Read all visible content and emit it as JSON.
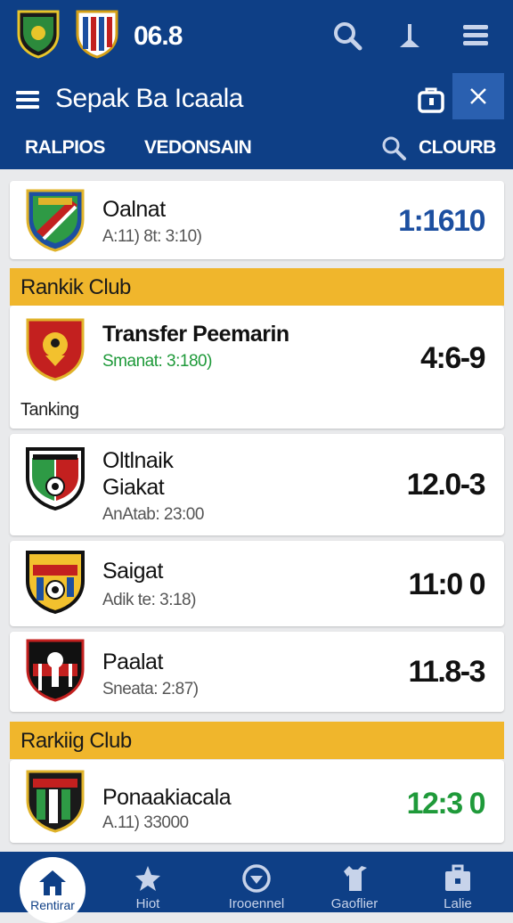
{
  "colors": {
    "appbar": "#0e3f86",
    "close_button": "#2a60b0",
    "section": "#f0b62c",
    "score_blue": "#1c4fa0",
    "score_green": "#1f9a3a",
    "background": "#e9eaec"
  },
  "topbar": {
    "score": "06.8",
    "icons": [
      "search-icon",
      "pin-icon",
      "menu-lines-icon"
    ]
  },
  "titlebar": {
    "title": "Sepak Ba Icaala",
    "icons": [
      "menu-icon",
      "bag-icon",
      "close-icon"
    ]
  },
  "tabs": [
    {
      "label": "RALPIOS"
    },
    {
      "label": "VEDONSAIN"
    },
    {
      "label": "CLOURB"
    }
  ],
  "cards": [
    {
      "name": "Oalnat",
      "sub": "A:11) 8t: 3:10)",
      "score": "1:1610"
    },
    {
      "name": "Transfer Peemarin",
      "sub": "Smanat: 3:180)",
      "score": "4:6-9",
      "footer": "Tanking"
    },
    {
      "name": "Oltlnaik",
      "name2": "Giakat",
      "sub": "AnAtab: 23:00",
      "score": "12.0-3"
    },
    {
      "name": "Saigat",
      "sub": "Adik te: 3:18)",
      "score": "11:0 0"
    },
    {
      "name": "Paalat",
      "sub": "Sneata: 2:87)",
      "score": "11.8-3"
    },
    {
      "name": "Ponaakiacala",
      "sub": "A.11) 33000",
      "score": "12:3 0"
    }
  ],
  "sections": [
    {
      "label": "Rankik Club"
    },
    {
      "label": "Rarkiig Club"
    }
  ],
  "bottom_nav": [
    {
      "label": "Rentirar",
      "icon": "home-icon"
    },
    {
      "label": "Hiot",
      "icon": "star-icon"
    },
    {
      "label": "Irooennel",
      "icon": "target-icon"
    },
    {
      "label": "Gaoflier",
      "icon": "shirt-icon"
    },
    {
      "label": "Lalie",
      "icon": "briefcase-icon"
    }
  ]
}
